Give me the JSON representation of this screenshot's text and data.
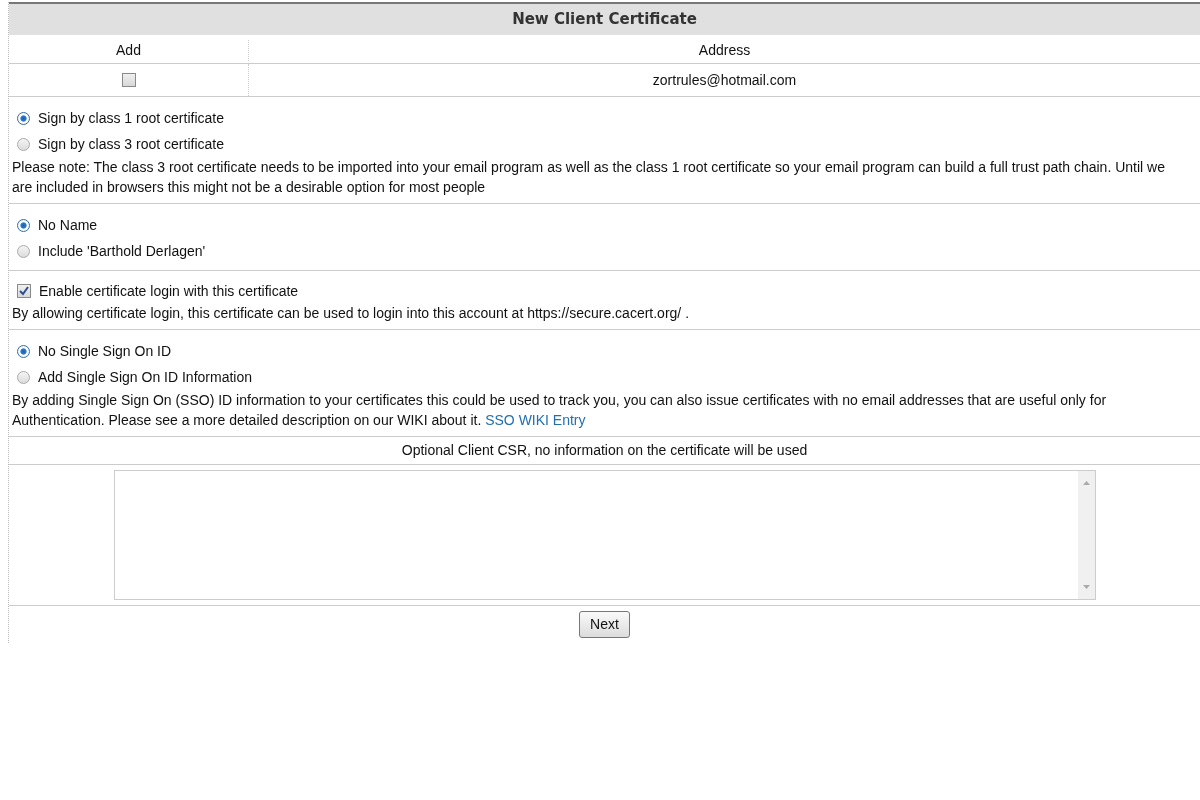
{
  "title": "New Client Certificate",
  "columns": [
    "Add",
    "Address"
  ],
  "addresses": [
    {
      "checked": false,
      "address": "zortrules@hotmail.com"
    }
  ],
  "sections": [
    {
      "kind": "radio",
      "options": [
        {
          "label": "Sign by class 1 root certificate",
          "selected": true
        },
        {
          "label": "Sign by class 3 root certificate",
          "selected": false
        }
      ],
      "note": "Please note: The class 3 root certificate needs to be imported into your email program as well as the class 1 root certificate so your email program can build a full trust path chain. Until we are included in browsers this might not be a desirable option for most people"
    },
    {
      "kind": "radio",
      "options": [
        {
          "label": "No Name",
          "selected": true
        },
        {
          "label": "Include 'Barthold Derlagen'",
          "selected": false
        }
      ]
    },
    {
      "kind": "checkbox",
      "label": "Enable certificate login with this certificate",
      "checked": true,
      "note": "By allowing certificate login, this certificate can be used to login into this account at https://secure.cacert.org/ ."
    },
    {
      "kind": "radio",
      "options": [
        {
          "label": "No Single Sign On ID",
          "selected": true
        },
        {
          "label": "Add Single Sign On ID Information",
          "selected": false
        }
      ],
      "note": "By adding Single Sign On (SSO) ID information to your certificates this could be used to track you, you can also issue certificates with no email addresses that are useful only for Authentication. Please see a more detailed description on our WIKI about it.",
      "link": "SSO WIKI Entry"
    }
  ],
  "csr_label": "Optional Client CSR, no information on the certificate will be used",
  "button": "Next"
}
